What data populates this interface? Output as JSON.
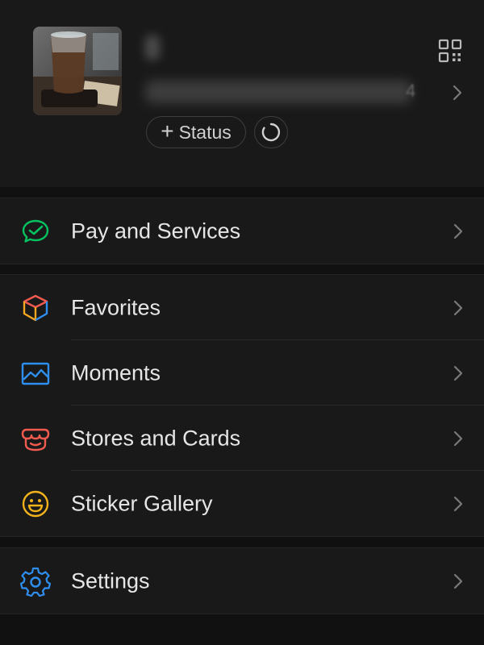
{
  "profile": {
    "status_button_label": "Status",
    "status_plus_symbol": "+",
    "id_tail_char": "4",
    "icons": {
      "qr": "qr-code-icon",
      "chevron": "chevron-right-icon",
      "status_ring": "status-ring-icon"
    }
  },
  "groups": [
    {
      "items": [
        {
          "label": "Pay and Services",
          "icon": "pay-services-icon",
          "color": "#07c160"
        }
      ]
    },
    {
      "items": [
        {
          "label": "Favorites",
          "icon": "favorites-cube-icon",
          "color": "#f5a623"
        },
        {
          "label": "Moments",
          "icon": "moments-image-icon",
          "color": "#2f8ff0"
        },
        {
          "label": "Stores and Cards",
          "icon": "stores-icon",
          "color": "#f25b4f"
        },
        {
          "label": "Sticker Gallery",
          "icon": "sticker-smile-icon",
          "color": "#f2b21c"
        }
      ]
    },
    {
      "items": [
        {
          "label": "Settings",
          "icon": "settings-gear-icon",
          "color": "#2f8ff0"
        }
      ]
    }
  ],
  "colors": {
    "background": "#111111",
    "panel": "#191919",
    "text": "#e6e6e6",
    "chevron": "#7a7a7a"
  }
}
